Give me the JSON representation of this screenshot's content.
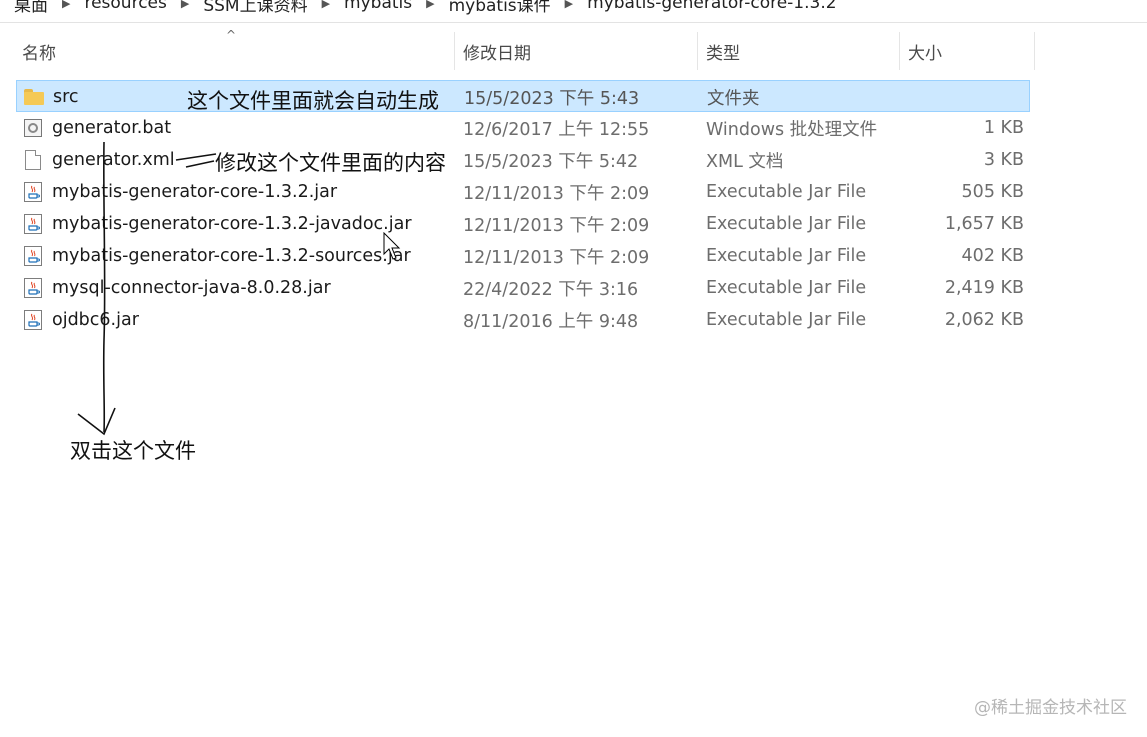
{
  "breadcrumb": [
    "桌面",
    "resources",
    "SSM上课资料",
    "mybatis",
    "mybatis课件",
    "mybatis-generator-core-1.3.2"
  ],
  "columns": {
    "name": "名称",
    "date": "修改日期",
    "type": "类型",
    "size": "大小"
  },
  "sort_indicator": "^",
  "files": [
    {
      "name": "src",
      "date": "15/5/2023 下午 5:43",
      "type": "文件夹",
      "size": "",
      "icon": "folder-icon",
      "selected": true
    },
    {
      "name": "generator.bat",
      "date": "12/6/2017 上午 12:55",
      "type": "Windows 批处理文件",
      "size": "1 KB",
      "icon": "batch-file-icon",
      "selected": false
    },
    {
      "name": "generator.xml",
      "date": "15/5/2023 下午 5:42",
      "type": "XML 文档",
      "size": "3 KB",
      "icon": "xml-file-icon",
      "selected": false
    },
    {
      "name": "mybatis-generator-core-1.3.2.jar",
      "date": "12/11/2013 下午 2:09",
      "type": "Executable Jar File",
      "size": "505 KB",
      "icon": "jar-file-icon",
      "selected": false
    },
    {
      "name": "mybatis-generator-core-1.3.2-javadoc.jar",
      "date": "12/11/2013 下午 2:09",
      "type": "Executable Jar File",
      "size": "1,657 KB",
      "icon": "jar-file-icon",
      "selected": false
    },
    {
      "name": "mybatis-generator-core-1.3.2-sources.jar",
      "date": "12/11/2013 下午 2:09",
      "type": "Executable Jar File",
      "size": "402 KB",
      "icon": "jar-file-icon",
      "selected": false
    },
    {
      "name": "mysql-connector-java-8.0.28.jar",
      "date": "22/4/2022 下午 3:16",
      "type": "Executable Jar File",
      "size": "2,419 KB",
      "icon": "jar-file-icon",
      "selected": false
    },
    {
      "name": "ojdbc6.jar",
      "date": "8/11/2016 上午 9:48",
      "type": "Executable Jar File",
      "size": "2,062 KB",
      "icon": "jar-file-icon",
      "selected": false
    }
  ],
  "annotations": {
    "src_note": "这个文件里面就会自动生成",
    "xml_note": "修改这个文件里面的内容",
    "bat_note": "双击这个文件"
  },
  "watermark": "@稀土掘金技术社区",
  "colors": {
    "selection_bg": "#cce8ff",
    "selection_border": "#99d1ff",
    "folder": "#f5c955"
  }
}
